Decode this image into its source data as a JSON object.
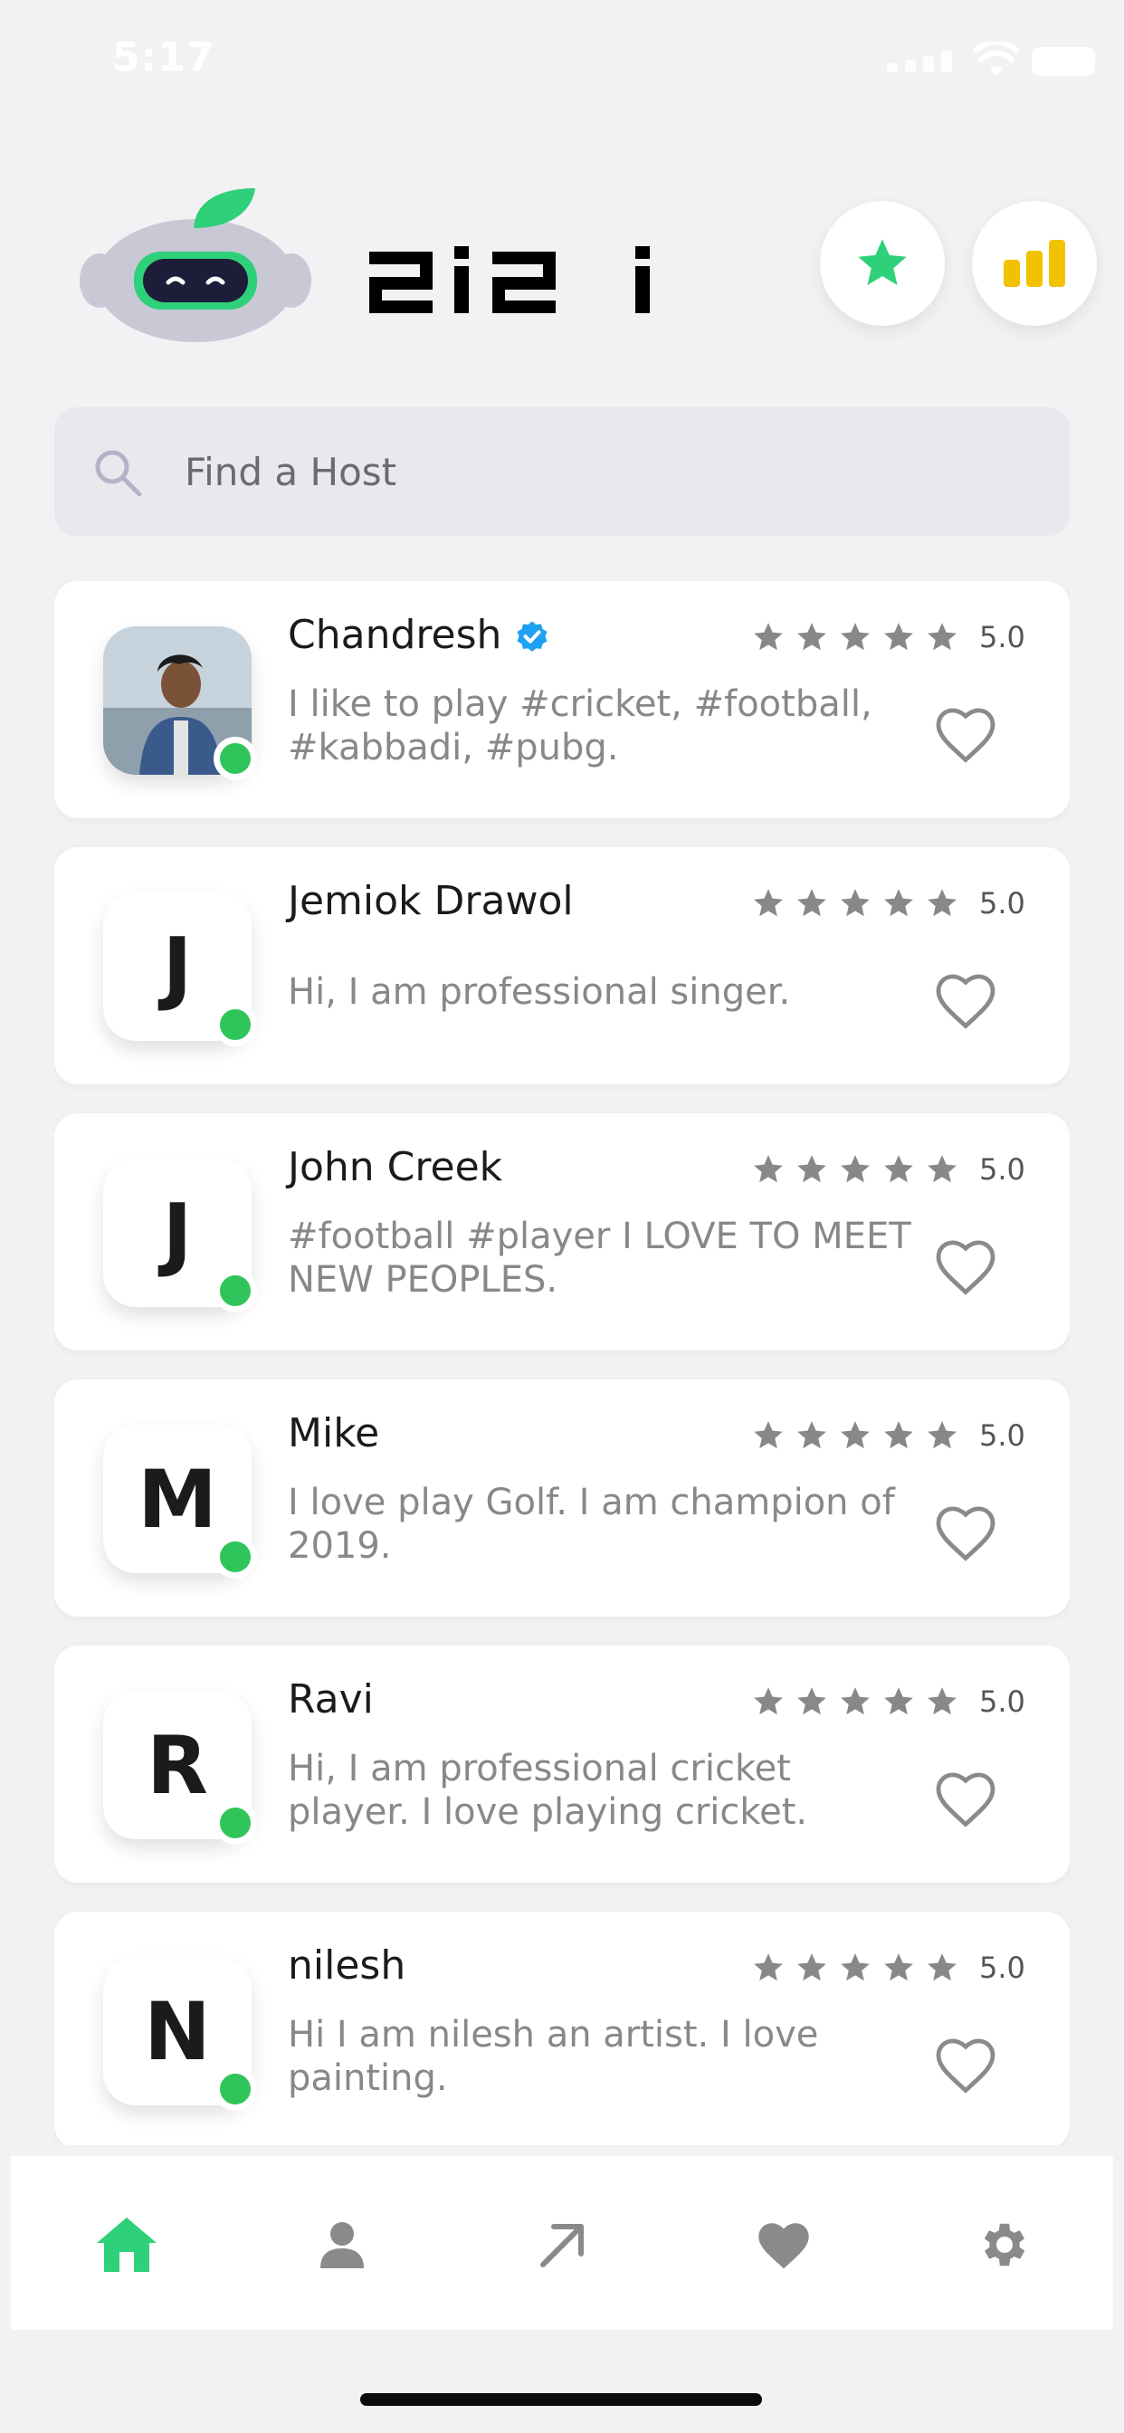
{
  "status_bar": {
    "time": "5:17"
  },
  "header": {
    "logo_alt": "zizi",
    "favorites_icon": "star-icon",
    "stats_icon": "bar-chart-icon"
  },
  "search": {
    "placeholder": "Find a Host",
    "value": ""
  },
  "hosts": [
    {
      "name": "Chandresh",
      "verified": true,
      "avatar_letter": "",
      "avatar_type": "photo",
      "rating": "5.0",
      "stars": 5,
      "bio": "I like to play #cricket, #football, #kabbadi, #pubg.",
      "online": true
    },
    {
      "name": "Jemiok Drawol",
      "verified": false,
      "avatar_letter": "J",
      "avatar_type": "letter",
      "rating": "5.0",
      "stars": 5,
      "bio": "Hi, I am professional singer.",
      "online": true
    },
    {
      "name": "John Creek",
      "verified": false,
      "avatar_letter": "J",
      "avatar_type": "letter",
      "rating": "5.0",
      "stars": 5,
      "bio": "#football #player I LOVE TO MEET NEW PEOPLES.",
      "online": true
    },
    {
      "name": "Mike",
      "verified": false,
      "avatar_letter": "M",
      "avatar_type": "letter",
      "rating": "5.0",
      "stars": 5,
      "bio": "I love play Golf. I am champion of 2019.",
      "online": true
    },
    {
      "name": "Ravi",
      "verified": false,
      "avatar_letter": "R",
      "avatar_type": "letter",
      "rating": "5.0",
      "stars": 5,
      "bio": "Hi, I am professional cricket player. I love playing cricket.",
      "online": true
    },
    {
      "name": "nilesh",
      "verified": false,
      "avatar_letter": "N",
      "avatar_type": "letter",
      "rating": "5.0",
      "stars": 5,
      "bio": "Hi I am nilesh an artist. I love painting.",
      "online": true
    }
  ],
  "bottom_nav": [
    {
      "icon": "home-icon",
      "active": true
    },
    {
      "icon": "user-icon",
      "active": false
    },
    {
      "icon": "arrow-up-right-icon",
      "active": false
    },
    {
      "icon": "heart-icon",
      "active": false
    },
    {
      "icon": "gear-icon",
      "active": false
    }
  ],
  "colors": {
    "accent": "#2fd07a",
    "online": "#2fc55a",
    "star": "#888888",
    "stats": "#f2c200",
    "verified": "#1da1f2",
    "nav_inactive": "#8a8a8a"
  }
}
